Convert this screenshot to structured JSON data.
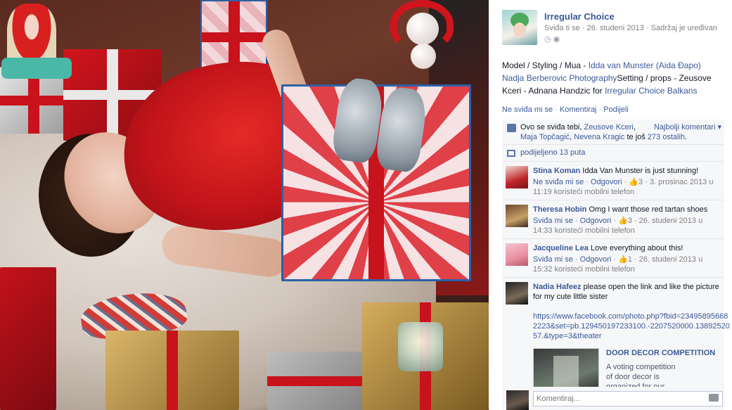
{
  "post": {
    "page_name": "Irregular Choice",
    "like_link": "Sviđa ti se",
    "date": "26. studeni 2013",
    "edited": "Sadržaj je uređivan",
    "sep": " · ",
    "description": {
      "prefix": "Model / Styling / Mua - ",
      "link1": "Idda van Munster (Aida Đapo)",
      "link2": "Nadja Berberovic Photography",
      "middle": "Setting / props - Zeusove Kceri - Adnana Handzic for ",
      "link3": "Irregular Choice Balkans"
    },
    "actions": {
      "unlike": "Ne sviđa mi se",
      "comment": "Komentiraj",
      "share": "Podijeli"
    }
  },
  "ufi": {
    "likes_prefix": "Ovo se sviđa tebi, ",
    "likers": [
      "Zeusove Kceri",
      "Maja Topčagić",
      "Nevena Kragic"
    ],
    "likes_middle": " te još ",
    "others": "273 ostalih",
    "sort_label": "Najbolji komentari ▾",
    "shares_prefix": "podijeljeno ",
    "shares_count": "13 puta"
  },
  "comments": [
    {
      "name": "Stina Koman",
      "text": "Idda Van Munster is just stunning!",
      "unlike": "Ne sviđa mi se",
      "reply": "Odgovori",
      "likes": "3",
      "meta": "3. prosinac 2013 u 11:19 koristeći mobilni telefon"
    },
    {
      "name": "Theresa Hobin",
      "text": "Omg I want those red tartan shoes",
      "unlike": "Sviđa mi se",
      "reply": "Odgovori",
      "likes": "3",
      "meta": "26. studeni 2013 u 14:33 koristeći mobilni telefon"
    },
    {
      "name": "Jacqueline Lea",
      "text": "Love everything about this!",
      "unlike": "Sviđa mi se",
      "reply": "Odgovori",
      "likes": "1",
      "meta": "26. studeni 2013 u 15:32 koristeći mobilni telefon"
    },
    {
      "name": "Nadia Hafeez",
      "text": "please open the link and like the picture for my cute little sister",
      "link": "https://www.facebook.com/photo.php?fbid=234958956682223&set=pb.129450197233100.-2207520000.1389252057.&type=3&theater",
      "preview_title": "DOOR DECOR COMPETITION",
      "preview_desc": "A voting competition of door decor is organized for our audience.You have to"
    }
  ],
  "composer": {
    "placeholder": "Komentiraj..."
  }
}
